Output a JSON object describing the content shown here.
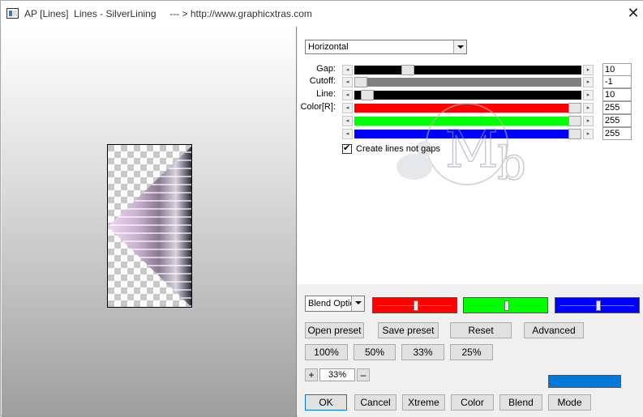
{
  "window": {
    "title": "AP [Lines]  Lines - SilverLining     --- > http://www.graphicxtras.com"
  },
  "controls": {
    "direction": {
      "value": "Horizontal"
    },
    "sliders": [
      {
        "label": "Gap:",
        "value": "10",
        "level": 0.22
      },
      {
        "label": "Cutoff:",
        "value": "-1",
        "level": 0.0
      },
      {
        "label": "Line:",
        "value": "10",
        "level": 0.03
      },
      {
        "label": "Color[R]:",
        "value": "255",
        "level": 1.0
      },
      {
        "label": "",
        "value": "255",
        "level": 1.0
      },
      {
        "label": "",
        "value": "255",
        "level": 1.0
      }
    ],
    "checkbox": {
      "label": "Create lines not gaps",
      "checked": true
    },
    "blend_options": {
      "value": "Blend Optio"
    },
    "color_sliders": [
      {
        "color": "#ff0000",
        "level": 0.5
      },
      {
        "color": "#00ff00",
        "level": 0.5
      },
      {
        "color": "#0000ff",
        "level": 0.5
      }
    ]
  },
  "buttons": {
    "open_preset": "Open preset",
    "save_preset": "Save preset",
    "reset": "Reset",
    "advanced": "Advanced",
    "zoom_100": "100%",
    "zoom_50": "50%",
    "zoom_33": "33%",
    "zoom_25": "25%",
    "zoom_plus": "+",
    "zoom_minus": "–",
    "ok": "OK",
    "cancel": "Cancel",
    "xtreme": "Xtreme",
    "color": "Color",
    "blend": "Blend",
    "mode": "Mode"
  },
  "zoom": {
    "value": "33%"
  },
  "colors": {
    "gap_track": "#000000",
    "cutoff_track": "#808080",
    "line_track": "#000000",
    "red": "#ff0000",
    "green": "#00ff00",
    "blue": "#0000ff",
    "swatch": "#0078d7"
  },
  "icons": {
    "close": "close-icon",
    "app": "app-icon",
    "dropdown": "chevron-down-icon"
  }
}
